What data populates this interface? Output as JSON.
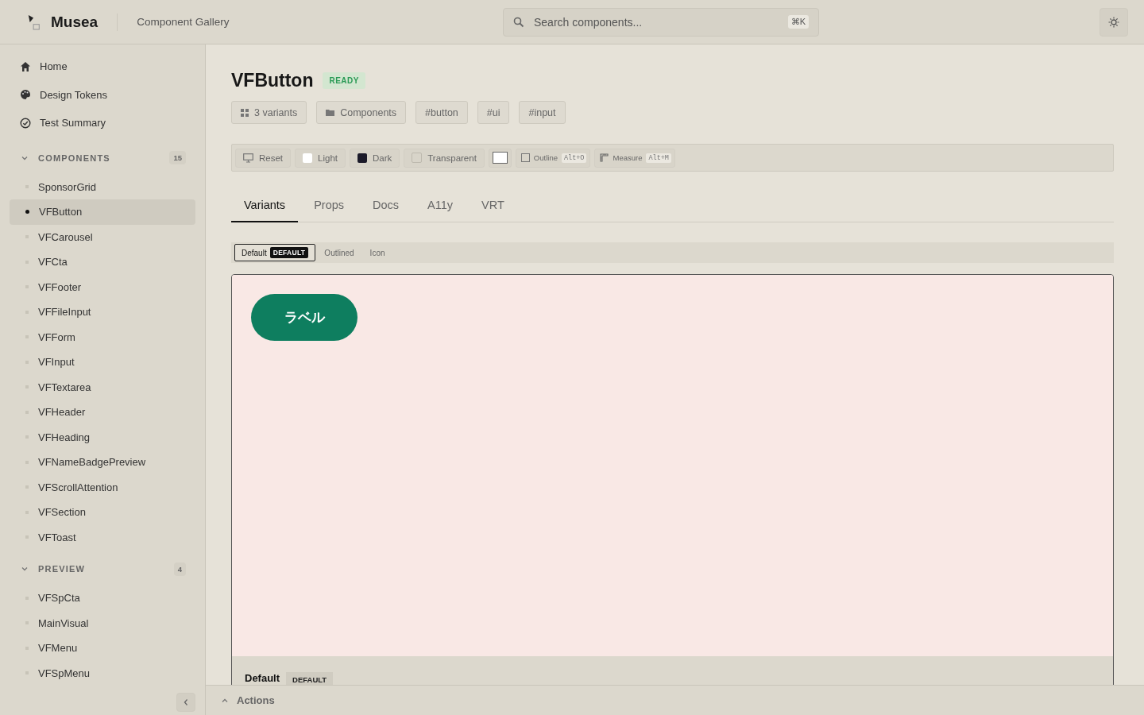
{
  "header": {
    "logo": "Musea",
    "subtitle": "Component Gallery",
    "search": {
      "placeholder": "Search components...",
      "shortcut": "⌘K"
    }
  },
  "nav": [
    {
      "kind": "home",
      "label": "Home"
    },
    {
      "kind": "palette",
      "label": "Design Tokens"
    },
    {
      "kind": "check",
      "label": "Test Summary"
    }
  ],
  "sections": [
    {
      "title": "COMPONENTS",
      "count": "15",
      "expanded": true,
      "items": [
        {
          "label": "SponsorGrid",
          "selected": false
        },
        {
          "label": "VFButton",
          "selected": true
        },
        {
          "label": "VFCarousel",
          "selected": false
        },
        {
          "label": "VFCta",
          "selected": false
        },
        {
          "label": "VFFooter",
          "selected": false
        },
        {
          "label": "VFFileInput",
          "selected": false
        },
        {
          "label": "VFForm",
          "selected": false
        },
        {
          "label": "VFInput",
          "selected": false
        },
        {
          "label": "VFTextarea",
          "selected": false
        },
        {
          "label": "VFHeader",
          "selected": false
        },
        {
          "label": "VFHeading",
          "selected": false
        },
        {
          "label": "VFNameBadgePreview",
          "selected": false
        },
        {
          "label": "VFScrollAttention",
          "selected": false
        },
        {
          "label": "VFSection",
          "selected": false
        },
        {
          "label": "VFToast",
          "selected": false
        }
      ]
    },
    {
      "title": "PREVIEW",
      "count": "4",
      "expanded": true,
      "items": [
        {
          "label": "VFSpCta",
          "selected": false
        },
        {
          "label": "MainVisual",
          "selected": false
        },
        {
          "label": "VFMenu",
          "selected": false
        },
        {
          "label": "VFSpMenu",
          "selected": false
        }
      ]
    }
  ],
  "component": {
    "title": "VFButton",
    "status": "READY",
    "chips": [
      {
        "kind": "variants",
        "label": "3 variants"
      },
      {
        "kind": "folder",
        "label": "Components"
      },
      {
        "kind": "tag",
        "label": "#button"
      },
      {
        "kind": "tag",
        "label": "#ui"
      },
      {
        "kind": "tag",
        "label": "#input"
      }
    ]
  },
  "toolbar": [
    {
      "kind": "reset",
      "label": "Reset"
    },
    {
      "kind": "swatch",
      "label": "Light",
      "color": "#ffffff"
    },
    {
      "kind": "swatch",
      "label": "Dark",
      "color": "#1c1b2a"
    },
    {
      "kind": "transparent",
      "label": "Transparent"
    },
    {
      "kind": "picker",
      "color": "#ffffff"
    },
    {
      "kind": "outline",
      "label": "Outline",
      "key": "Alt+O",
      "checked": false
    },
    {
      "kind": "measure",
      "label": "Measure",
      "key": "Alt+M"
    }
  ],
  "tabs": [
    {
      "label": "Variants",
      "selected": true
    },
    {
      "label": "Props",
      "selected": false
    },
    {
      "label": "Docs",
      "selected": false
    },
    {
      "label": "A11y",
      "selected": false
    },
    {
      "label": "VRT",
      "selected": false
    }
  ],
  "variants": [
    {
      "label": "Default",
      "badge": "DEFAULT",
      "selected": true
    },
    {
      "label": "Outlined",
      "selected": false
    },
    {
      "label": "Icon",
      "selected": false
    }
  ],
  "preview": {
    "button_label": "ラベル",
    "variant_name": "Default",
    "variant_badge": "DEFAULT"
  },
  "actions": {
    "label": "Actions",
    "expanded": false
  }
}
